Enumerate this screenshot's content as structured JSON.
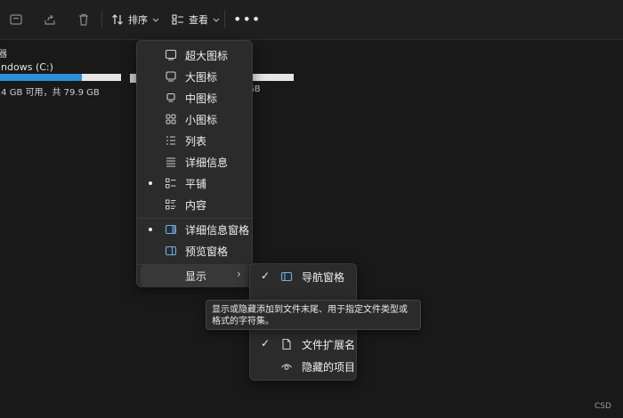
{
  "toolbar": {
    "sort_label": "排序",
    "view_label": "查看",
    "more_label": "•••"
  },
  "content": {
    "section_label": "器",
    "drive": {
      "name": "indows (C:)",
      "space_text": ".4 GB 可用，共 79.9 GB",
      "used_fraction": 0.68
    },
    "drive2": {
      "space_text": "GB",
      "used_fraction": 0
    }
  },
  "view_menu": {
    "items": [
      {
        "label": "超大图标",
        "icon": "extra-large-icons-icon",
        "selected": false
      },
      {
        "label": "大图标",
        "icon": "large-icons-icon",
        "selected": false
      },
      {
        "label": "中图标",
        "icon": "medium-icons-icon",
        "selected": false
      },
      {
        "label": "小图标",
        "icon": "small-icons-icon",
        "selected": false
      },
      {
        "label": "列表",
        "icon": "list-icon",
        "selected": false
      },
      {
        "label": "详细信息",
        "icon": "details-icon",
        "selected": false
      },
      {
        "label": "平铺",
        "icon": "tiles-icon",
        "selected": true
      },
      {
        "label": "内容",
        "icon": "content-icon",
        "selected": false
      }
    ],
    "panes": [
      {
        "label": "详细信息窗格",
        "icon": "details-pane-icon",
        "selected": true
      },
      {
        "label": "预览窗格",
        "icon": "preview-pane-icon",
        "selected": false
      }
    ],
    "show_label": "显示",
    "show_chevron": "›"
  },
  "show_submenu": {
    "items": [
      {
        "label": "导航窗格",
        "icon": "navigation-pane-icon",
        "checked": true,
        "check": "✓"
      },
      {
        "label": "文件扩展名",
        "icon": "file-extension-icon",
        "checked": true,
        "check": "✓"
      },
      {
        "label": "隐藏的项目",
        "icon": "eye-icon",
        "checked": false,
        "check": ""
      }
    ]
  },
  "tooltip": {
    "text": "显示或隐藏添加到文件末尾、用于指定文件类型或格式的字符集。"
  },
  "watermark": "CSD"
}
